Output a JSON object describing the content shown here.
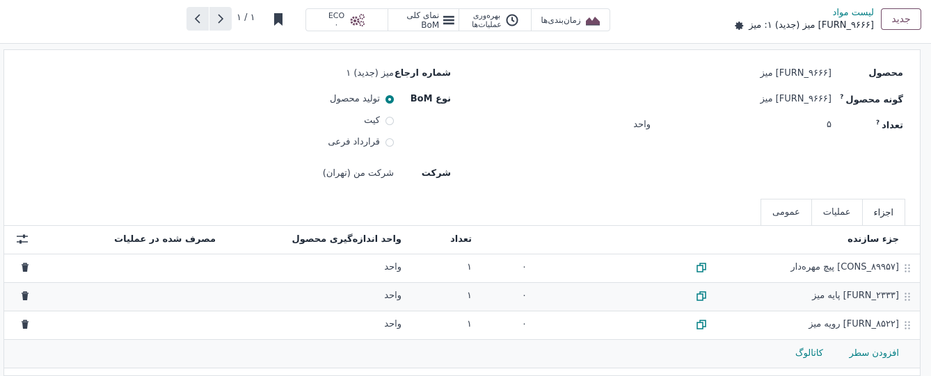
{
  "header": {
    "new_button": "جدید",
    "breadcrumb_parent": "لیست مواد",
    "breadcrumb_current": "[FURN_۹۶۶۶] میز (جدید) ۱: میز",
    "pager": "۱ / ۱"
  },
  "smart_buttons": {
    "scheduling": "زمان‌بندی‌ها",
    "operations_line1": "بهره‌وری",
    "operations_line2": "عملیات‌ها",
    "overview": "نمای کلی BoM",
    "eco_label": "ECO",
    "eco_count": "۰"
  },
  "form": {
    "product_label": "محصول",
    "product_value": "[FURN_۹۶۶۶] میز",
    "variant_label": "گونه محصول",
    "variant_value": "[FURN_۹۶۶۶] میز",
    "qty_label": "تعداد",
    "qty_value": "۵",
    "qty_unit": "واحد",
    "help_mark": "?",
    "ref_label": "شماره ارجاع",
    "ref_value": "میز (جدید) ۱",
    "type_label": "نوع BoM",
    "type_options": [
      "تولید محصول",
      "کیت",
      "قرارداد فرعی"
    ],
    "type_selected": "تولید محصول",
    "company_label": "شرکت",
    "company_value": "شرکت من (تهران)"
  },
  "tabs": [
    "اجزاء",
    "عملیات",
    "عمومی"
  ],
  "table": {
    "columns": [
      "جزء سازنده",
      "تعداد",
      "واحد اندازه‌گیری محصول",
      "مصرف شده در عملیات"
    ],
    "rows": [
      {
        "component": "[CONS_۸۹۹۵۷] پیچ مهره‌دار",
        "extra": "۰",
        "qty": "۱",
        "uom": "واحد"
      },
      {
        "component": "[FURN_۲۳۳۳] پایه میز",
        "extra": "۰",
        "qty": "۱",
        "uom": "واحد"
      },
      {
        "component": "[FURN_۸۵۲۲] رویه میز",
        "extra": "۰",
        "qty": "۱",
        "uom": "واحد"
      }
    ],
    "add_line": "افزودن سطر",
    "catalog": "کاتالوگ"
  },
  "colors": {
    "accent": "#017e84",
    "brand": "#714b67"
  }
}
